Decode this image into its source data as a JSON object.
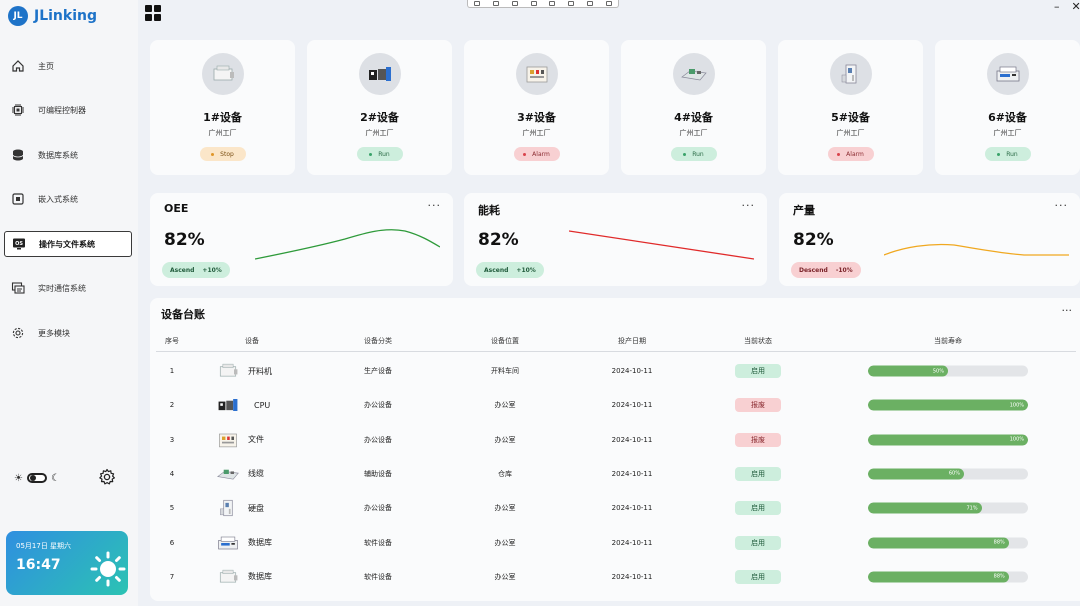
{
  "app": {
    "logo_badge": "JL",
    "name": "JLinking"
  },
  "sidebar": {
    "items": [
      {
        "label": "主页",
        "icon": "home-icon"
      },
      {
        "label": "可编程控制器",
        "icon": "chip-icon"
      },
      {
        "label": "数据库系统",
        "icon": "database-icon"
      },
      {
        "label": "嵌入式系统",
        "icon": "embedded-icon"
      },
      {
        "label": "操作与文件系统",
        "icon": "os-icon",
        "active": true
      },
      {
        "label": "实时通信系统",
        "icon": "communication-icon"
      },
      {
        "label": "更多模块",
        "icon": "gear-icon"
      }
    ],
    "os_badge": "OS"
  },
  "datetime": {
    "date": "05月17日  星期六",
    "time": "16:47"
  },
  "devices": [
    {
      "name": "1#设备",
      "location": "广州工厂",
      "status": "Stop",
      "kind": "stop"
    },
    {
      "name": "2#设备",
      "location": "广州工厂",
      "status": "Run",
      "kind": "run"
    },
    {
      "name": "3#设备",
      "location": "广州工厂",
      "status": "Alarm",
      "kind": "alarm"
    },
    {
      "name": "4#设备",
      "location": "广州工厂",
      "status": "Run",
      "kind": "run"
    },
    {
      "name": "5#设备",
      "location": "广州工厂",
      "status": "Alarm",
      "kind": "alarm"
    },
    {
      "name": "6#设备",
      "location": "广州工厂",
      "status": "Run",
      "kind": "run"
    }
  ],
  "kpis": [
    {
      "title": "OEE",
      "value": "82%",
      "trend": "Ascend",
      "change": "+10%",
      "kind": "up",
      "line_color": "#2e9a3a"
    },
    {
      "title": "能耗",
      "value": "82%",
      "trend": "Ascend",
      "change": "+10%",
      "kind": "up",
      "line_color": "#e02a2a"
    },
    {
      "title": "产量",
      "value": "82%",
      "trend": "Descend",
      "change": "-10%",
      "kind": "down",
      "line_color": "#f0a820"
    }
  ],
  "kpi_more": "···",
  "ledger": {
    "title": "设备台账",
    "more": "···",
    "columns": [
      "序号",
      "设备",
      "设备分类",
      "设备位置",
      "投产日期",
      "当前状态",
      "当前寿命"
    ],
    "rows": [
      {
        "no": "1",
        "device": "开料机",
        "category": "生产设备",
        "location": "开料车间",
        "date": "2024-10-11",
        "status": "启用",
        "on": true,
        "life": 50,
        "life_label": "50%"
      },
      {
        "no": "2",
        "device": "CPU",
        "category": "办公设备",
        "location": "办公室",
        "date": "2024-10-11",
        "status": "报废",
        "on": false,
        "life": 100,
        "life_label": "100%"
      },
      {
        "no": "3",
        "device": "文件",
        "category": "办公设备",
        "location": "办公室",
        "date": "2024-10-11",
        "status": "报废",
        "on": false,
        "life": 100,
        "life_label": "100%"
      },
      {
        "no": "4",
        "device": "线缆",
        "category": "辅助设备",
        "location": "仓库",
        "date": "2024-10-11",
        "status": "启用",
        "on": true,
        "life": 60,
        "life_label": "60%"
      },
      {
        "no": "5",
        "device": "硬盘",
        "category": "办公设备",
        "location": "办公室",
        "date": "2024-10-11",
        "status": "启用",
        "on": true,
        "life": 71,
        "life_label": "71%"
      },
      {
        "no": "6",
        "device": "数据库",
        "category": "软件设备",
        "location": "办公室",
        "date": "2024-10-11",
        "status": "启用",
        "on": true,
        "life": 88,
        "life_label": "88%"
      },
      {
        "no": "7",
        "device": "数据库",
        "category": "软件设备",
        "location": "办公室",
        "date": "2024-10-11",
        "status": "启用",
        "on": true,
        "life": 88,
        "life_label": "88%"
      }
    ]
  },
  "window": {
    "minimize": "–",
    "close": "✕"
  }
}
